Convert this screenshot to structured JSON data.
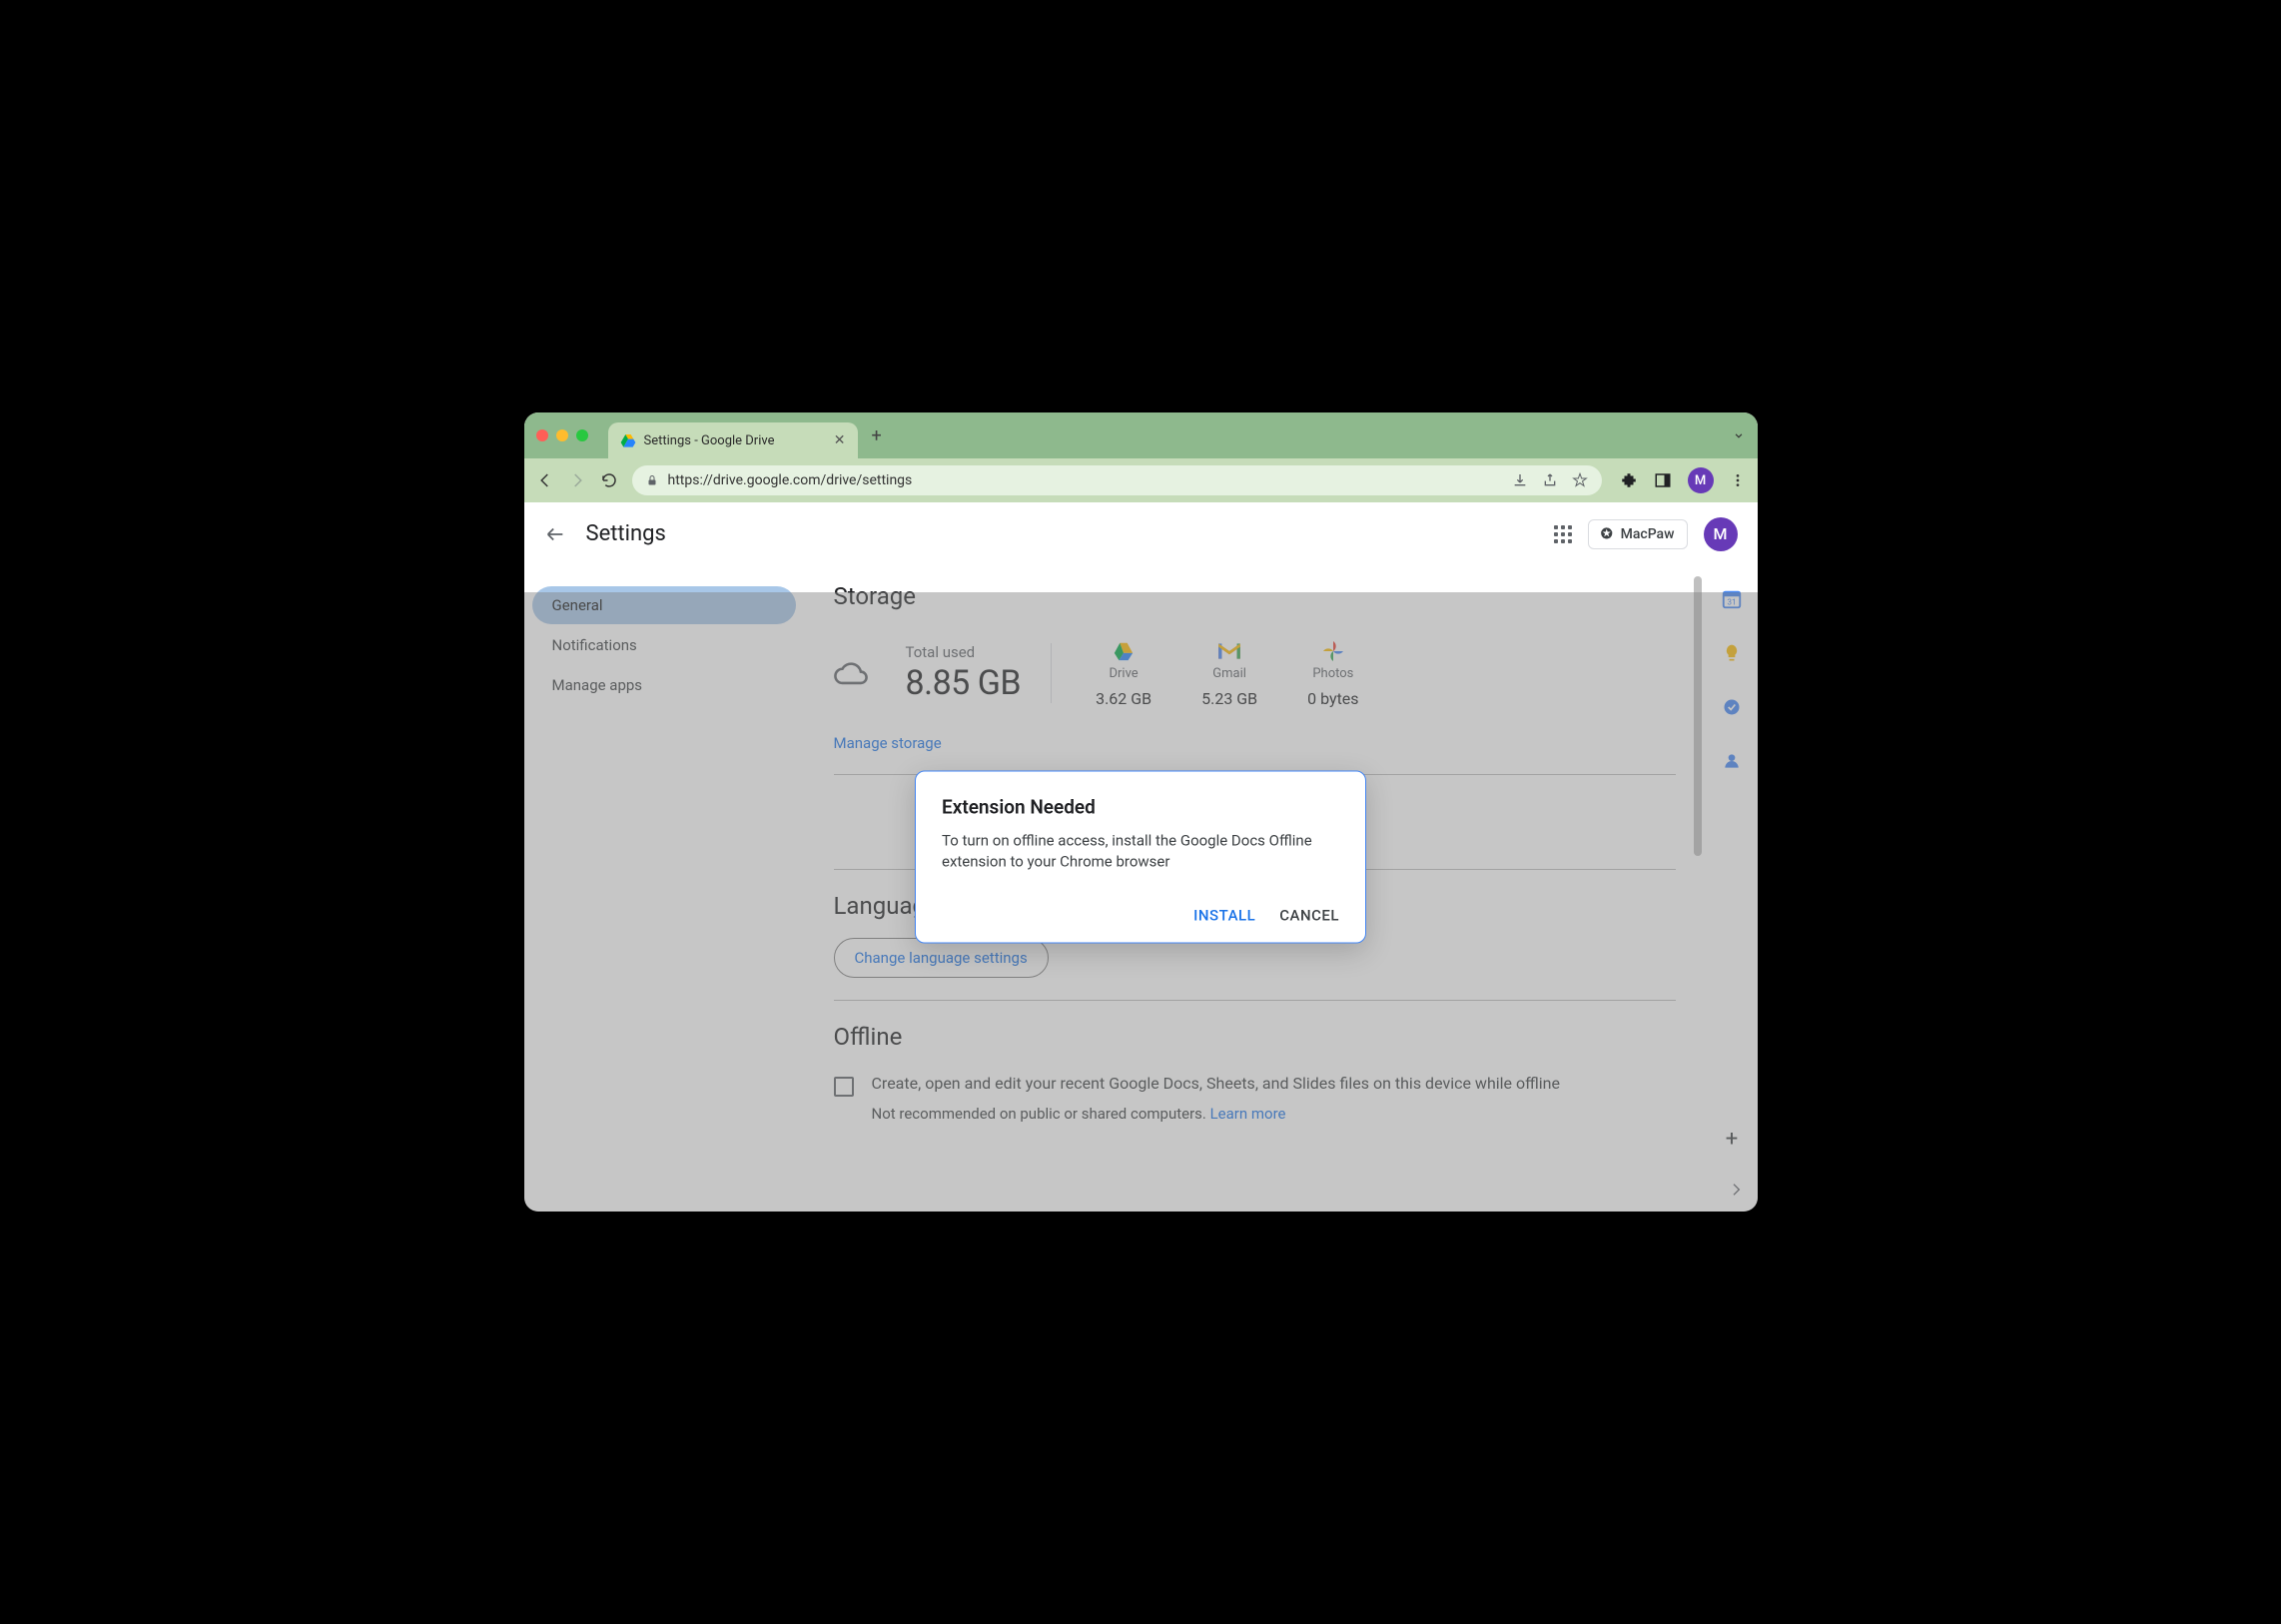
{
  "browser": {
    "tab_title": "Settings - Google Drive",
    "url": "https://drive.google.com/drive/settings",
    "avatar_letter": "M"
  },
  "header": {
    "title": "Settings",
    "org_name": "MacPaw",
    "avatar_letter": "M"
  },
  "sidebar": {
    "items": [
      {
        "label": "General",
        "active": true
      },
      {
        "label": "Notifications",
        "active": false
      },
      {
        "label": "Manage apps",
        "active": false
      }
    ]
  },
  "main": {
    "storage": {
      "title": "Storage",
      "total_label": "Total used",
      "total_value": "8.85 GB",
      "breakdown": [
        {
          "name": "Drive",
          "value": "3.62 GB"
        },
        {
          "name": "Gmail",
          "value": "5.23 GB"
        },
        {
          "name": "Photos",
          "value": "0 bytes"
        }
      ],
      "manage_link": "Manage storage"
    },
    "language": {
      "title": "Language",
      "button": "Change language settings"
    },
    "offline": {
      "title": "Offline",
      "desc": "Create, open and edit your recent Google Docs, Sheets, and Slides files on this device while offline",
      "note_prefix": "Not recommended on public or shared computers. ",
      "learn": "Learn more"
    }
  },
  "dialog": {
    "title": "Extension Needed",
    "body": "To turn on offline access, install the Google Docs Offline extension to your Chrome browser",
    "install": "INSTALL",
    "cancel": "CANCEL"
  }
}
